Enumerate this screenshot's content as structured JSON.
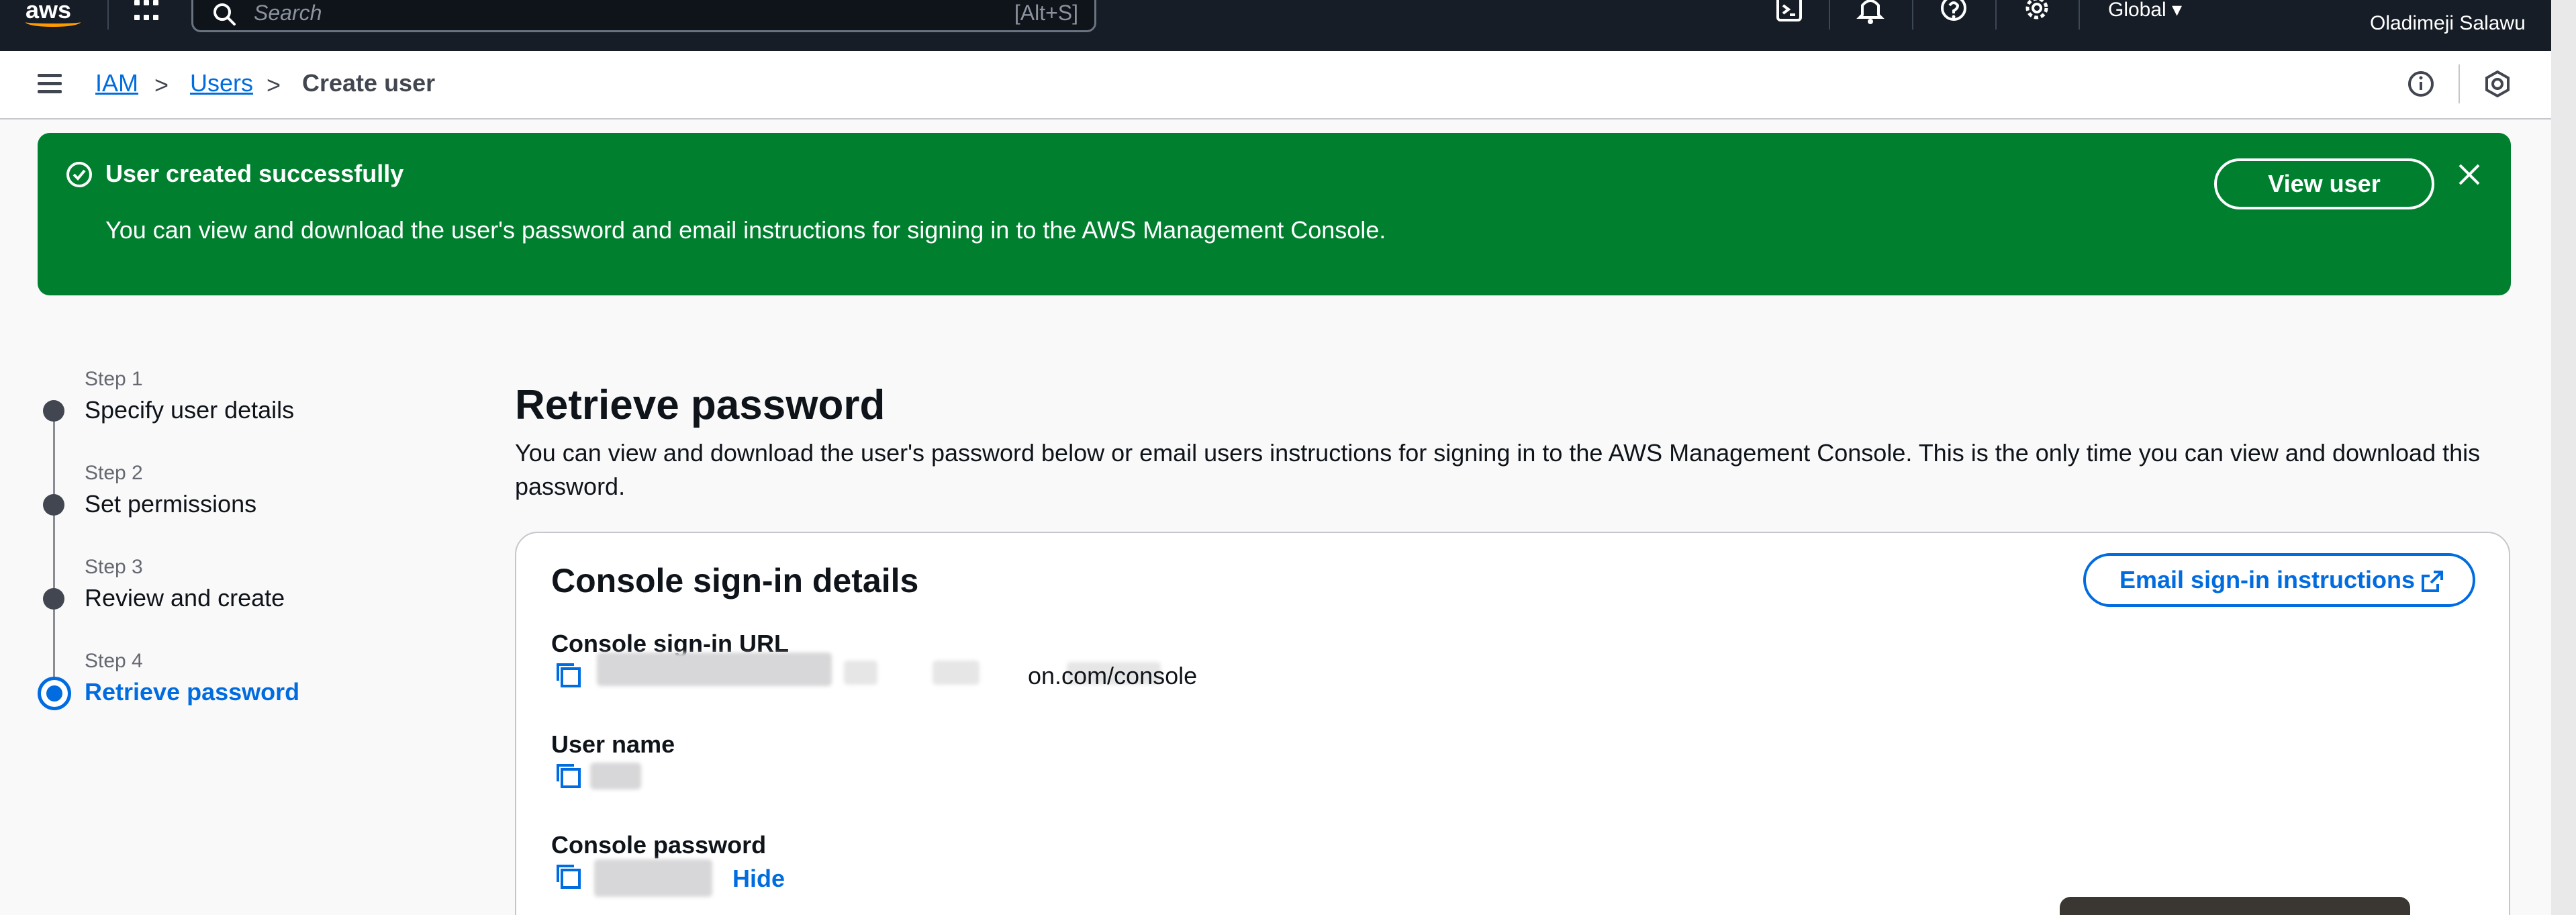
{
  "topnav": {
    "logo_text": "aws",
    "search_placeholder": "Search",
    "search_shortcut": "[Alt+S]",
    "region": "Global ▾",
    "user": "Oladimeji Salawu",
    "icons": [
      "cloudshell-icon",
      "bell-icon",
      "help-icon",
      "gear-icon"
    ]
  },
  "breadcrumb": {
    "items": [
      {
        "label": "IAM"
      },
      {
        "label": "Users"
      },
      {
        "label": "Create user"
      }
    ]
  },
  "flash": {
    "title": "User created successfully",
    "message": "You can view and download the user's password and email instructions for signing in to the AWS Management Console.",
    "view_user_label": "View user",
    "color": "#00802f"
  },
  "steps": [
    {
      "label": "Step 1",
      "name": "Specify user details"
    },
    {
      "label": "Step 2",
      "name": "Set permissions"
    },
    {
      "label": "Step 3",
      "name": "Review and create"
    },
    {
      "label": "Step 4",
      "name": "Retrieve password"
    }
  ],
  "main": {
    "title": "Retrieve password",
    "description": "You can view and download the user's password below or email users instructions for signing in to the AWS Management Console. This is the only time you can view and download this password.",
    "card": {
      "title": "Console sign-in details",
      "email_button": "Email sign-in instructions",
      "fields": [
        {
          "label": "Console sign-in URL",
          "value": "on.com/console"
        },
        {
          "label": "User name",
          "value": ""
        },
        {
          "label": "Console password",
          "value": "",
          "action": "Hide"
        }
      ]
    }
  },
  "accent_color": "#006ce0"
}
